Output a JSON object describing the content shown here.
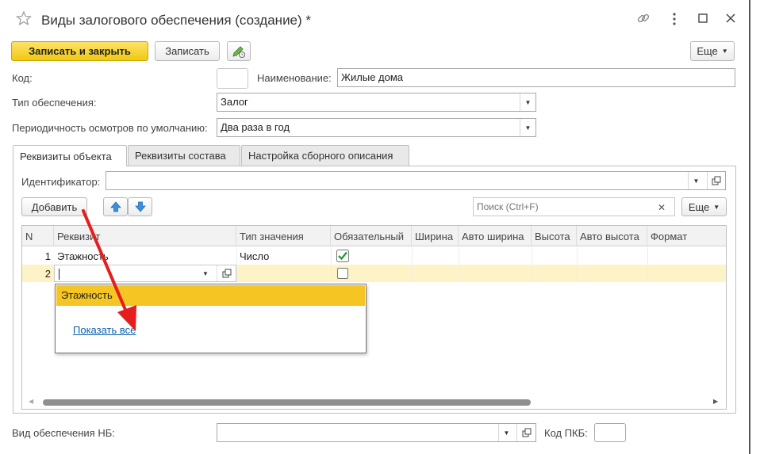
{
  "window": {
    "title": "Виды залогового обеспечения (создание) *"
  },
  "toolbar": {
    "save_close_label": "Записать и закрыть",
    "save_label": "Записать",
    "more_label": "Еще"
  },
  "form": {
    "code_label": "Код:",
    "code_value": "",
    "name_label": "Наименование:",
    "name_value": "Жилые дома",
    "type_label": "Тип обеспечения:",
    "type_value": "Залог",
    "period_label": "Периодичность осмотров по умолчанию:",
    "period_value": "Два раза в год",
    "nb_label": "Вид обеспечения НБ:",
    "nb_value": "",
    "pkb_label": "Код ПКБ:",
    "pkb_value": ""
  },
  "tabs": [
    {
      "label": "Реквизиты объекта"
    },
    {
      "label": "Реквизиты состава"
    },
    {
      "label": "Настройка сборного описания"
    }
  ],
  "panel": {
    "id_label": "Идентификатор:",
    "id_value": "",
    "add_label": "Добавить",
    "search_placeholder": "Поиск (Ctrl+F)",
    "more_label": "Еще"
  },
  "table": {
    "columns": [
      "N",
      "Реквизит",
      "Тип значения",
      "Обязательный",
      "Ширина",
      "Авто ширина",
      "Высота",
      "Авто высота",
      "Формат"
    ],
    "rows": [
      {
        "n": "1",
        "attr": "Этажность",
        "type": "Число",
        "required": true
      },
      {
        "n": "2",
        "attr": "",
        "type": "",
        "required": false
      }
    ]
  },
  "dropdown": {
    "item": "Этажность",
    "show_all": "Показать все"
  },
  "colors": {
    "primary_button": "#f2c811",
    "selected_row": "#fdf3c7",
    "dropdown_highlight": "#f5c623",
    "arrow": "#e51d1d",
    "link": "#0a5eb0"
  }
}
